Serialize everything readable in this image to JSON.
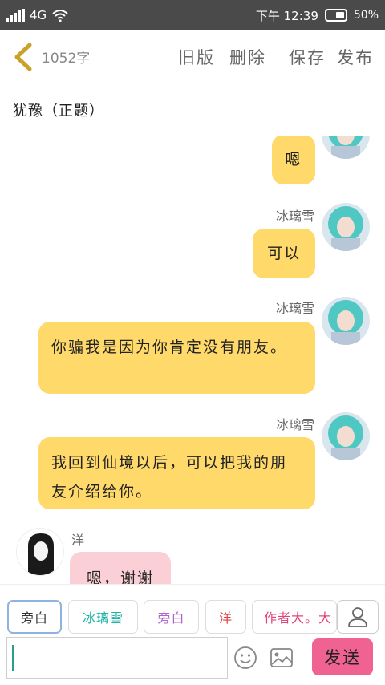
{
  "status_bar": {
    "network": "4G",
    "time": "下午 12:39",
    "battery": "50%"
  },
  "toolbar": {
    "word_count": "1052字",
    "old_version": "旧版",
    "delete": "删除",
    "save": "保存",
    "publish": "发布"
  },
  "title": "犹豫（正题）",
  "messages": [
    {
      "side": "right",
      "sender": "",
      "text": "嗯"
    },
    {
      "side": "right",
      "sender": "冰璃雪",
      "text": "可以"
    },
    {
      "side": "right",
      "sender": "冰璃雪",
      "text": "你骗我是因为你肯定没有朋友。"
    },
    {
      "side": "right",
      "sender": "冰璃雪",
      "text": "我回到仙境以后，可以把我的朋友介绍给你。"
    },
    {
      "side": "left",
      "sender": "洋",
      "text": "嗯，谢谢"
    }
  ],
  "characters": [
    {
      "label": "旁白",
      "color": "#333333",
      "selected": true
    },
    {
      "label": "冰璃雪",
      "color": "#1fb5a6",
      "selected": false
    },
    {
      "label": "旁白",
      "color": "#b066c8",
      "selected": false
    },
    {
      "label": "洋",
      "color": "#e04040",
      "selected": false
    },
    {
      "label": "作者大。大",
      "color": "#e0457b",
      "selected": false
    }
  ],
  "input": {
    "value": "",
    "placeholder": ""
  },
  "send_label": "发送",
  "icons": [
    "back-arrow-icon",
    "emoji-icon",
    "image-icon",
    "user-icon"
  ],
  "colors": {
    "accent": "#f06292",
    "bubble_right": "#ffd96a",
    "bubble_left": "#fbcfd6",
    "back_arrow": "#c9a227"
  }
}
